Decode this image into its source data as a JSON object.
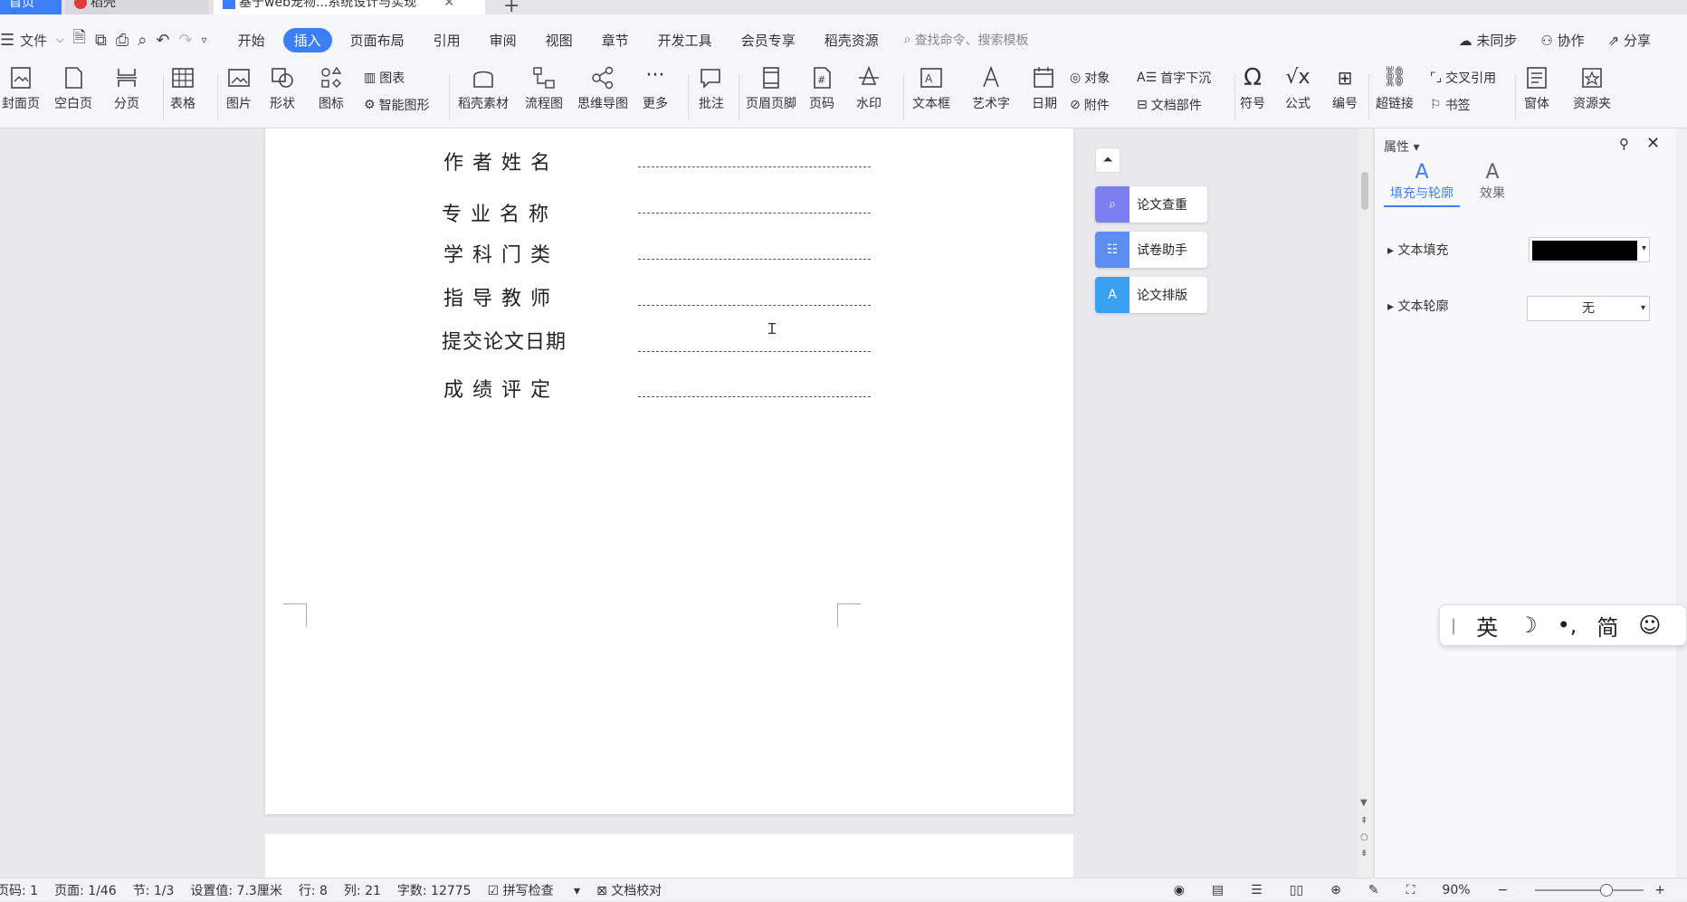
{
  "tabs": {
    "home": "首页",
    "daoke": "稻壳",
    "doc": "基于web宠物...系统设计与实现"
  },
  "menu": {
    "file": "文件",
    "items": [
      "开始",
      "插入",
      "页面布局",
      "引用",
      "审阅",
      "视图",
      "章节",
      "开发工具",
      "会员专享",
      "稻壳资源"
    ],
    "search_placeholder": "查找命令、搜索模板",
    "sync": "未同步",
    "collab": "协作",
    "share": "分享"
  },
  "ribbon": {
    "cover": "封面页",
    "blank": "空白页",
    "break": "分页",
    "table": "表格",
    "picture": "图片",
    "shape": "形状",
    "icon": "图标",
    "chart": "图表",
    "smart": "智能图形",
    "daoke": "稻壳素材",
    "flow": "流程图",
    "mind": "思维导图",
    "more": "更多",
    "comment": "批注",
    "header": "页眉页脚",
    "pagenum": "页码",
    "watermark": "水印",
    "textbox": "文本框",
    "wordart": "艺术字",
    "date": "日期",
    "object": "对象",
    "attach": "附件",
    "dropcap": "首字下沉",
    "parts": "文档部件",
    "symbol": "符号",
    "formula": "公式",
    "number": "编号",
    "hyperlink": "超链接",
    "crossref": "交叉引用",
    "bookmark": "书签",
    "window": "窗体",
    "folder": "资源夹"
  },
  "fields": [
    "作者姓名",
    "专业名称",
    "学科门类",
    "指导教师",
    "提交论文日期",
    "成绩评定"
  ],
  "tools": [
    "论文查重",
    "试卷助手",
    "论文排版"
  ],
  "props": {
    "title": "属性",
    "tab_fill": "填充与轮廓",
    "tab_effect": "效果",
    "text_fill": "文本填充",
    "text_outline": "文本轮廓",
    "outline_value": "无",
    "fill_color": "#000000"
  },
  "ime": [
    "英",
    "☽",
    "•,",
    "简",
    "☺"
  ],
  "status": {
    "page_code": "页码: 1",
    "page": "页面: 1/46",
    "section": "节: 1/3",
    "setting": "设置值: 7.3厘米",
    "row": "行: 8",
    "col": "列: 21",
    "words": "字数: 12775",
    "spell": "拼写检查",
    "proof": "文档校对",
    "zoom": "90%"
  }
}
